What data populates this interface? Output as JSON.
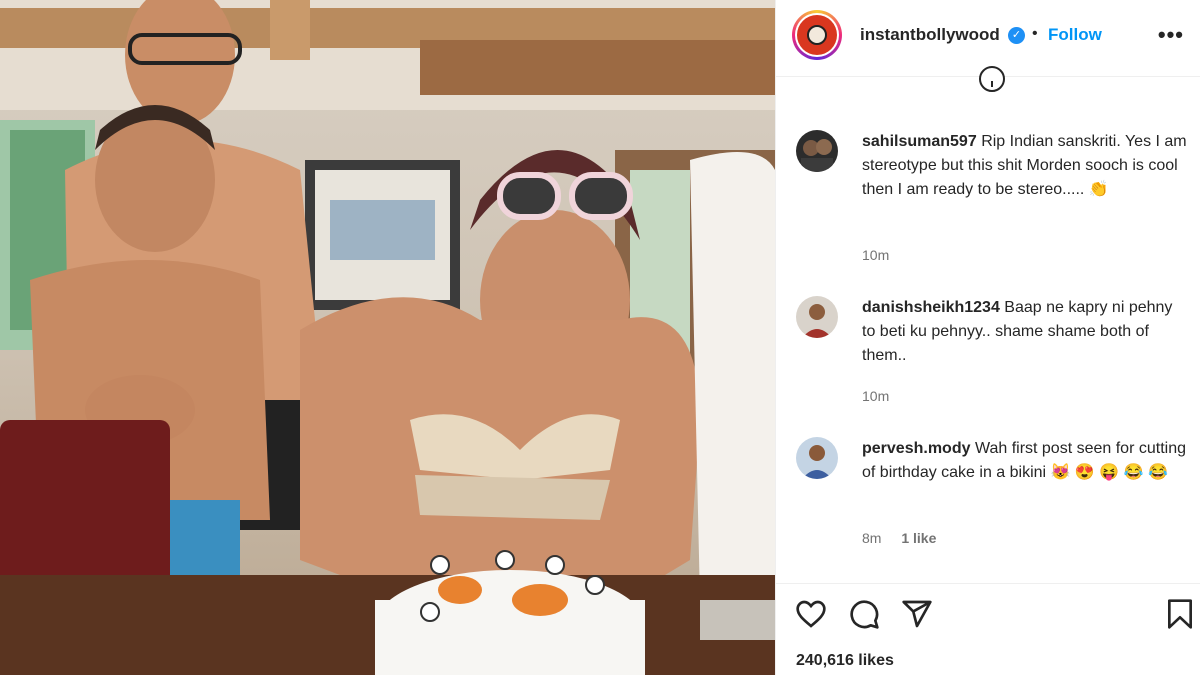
{
  "post": {
    "account": "instantbollywood",
    "follow_label": "Follow",
    "separator": "•",
    "more_label": "•••",
    "likes_text": "240,616 likes"
  },
  "comments": [
    {
      "username": "sahilsuman597",
      "text": "Rip Indian sanskriti. Yes I am stereotype but this shit Morden sooch is cool then I am ready to be stereo..... 👏",
      "time": "10m",
      "likes": ""
    },
    {
      "username": "danishsheikh1234",
      "text": "Baap ne kapry ni pehny to beti ku pehnyy.. shame shame both of them..",
      "time": "10m",
      "likes": ""
    },
    {
      "username": "pervesh.mody",
      "text": "Wah first post seen for cutting of birthday cake in a bikini 😻 😍 😝 😂 😂",
      "time": "8m",
      "likes": "1 like"
    }
  ],
  "icons": [
    "verified-badge-icon",
    "info-icon",
    "heart-icon",
    "comment-icon",
    "share-icon",
    "bookmark-icon"
  ],
  "colors": {
    "link": "#0095f6",
    "muted": "#737373",
    "text": "#262626",
    "verified": "#1e90f5"
  }
}
